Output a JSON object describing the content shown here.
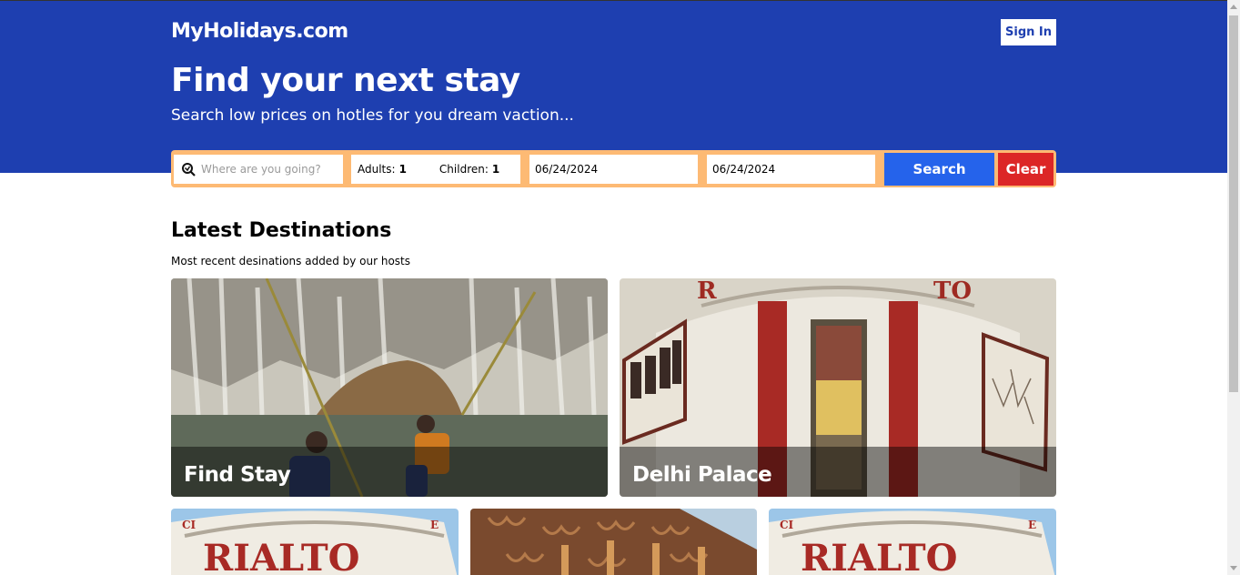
{
  "header": {
    "logo": "MyHolidays.com",
    "sign_in_label": "Sign In",
    "headline": "Find your next stay",
    "subheadline": "Search low prices on hotles for you dream vaction..."
  },
  "search": {
    "destination_placeholder": "Where are you going?",
    "destination_value": "",
    "adults_label": "Adults:",
    "adults_value": "1",
    "children_label": "Children:",
    "children_value": "1",
    "check_in": "06/24/2024",
    "check_out": "06/24/2024",
    "search_label": "Search",
    "clear_label": "Clear"
  },
  "section": {
    "title": "Latest Destinations",
    "subtitle": "Most recent desinations added by our hosts"
  },
  "destinations": [
    {
      "name": "Find Stay"
    },
    {
      "name": "Delhi Palace"
    }
  ],
  "colors": {
    "brand_blue": "#1e3fb0",
    "search_border": "#fdba74",
    "search_button": "#2563eb",
    "clear_button": "#dc2626"
  }
}
